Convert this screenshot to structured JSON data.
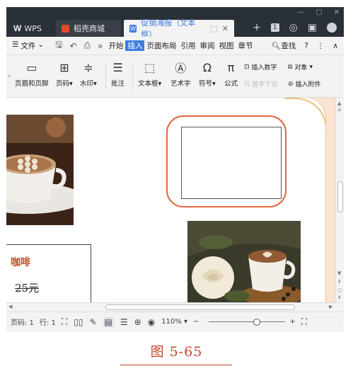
{
  "titlebar": {
    "app_name": "WPS",
    "tabs": [
      {
        "label": "稻壳商城",
        "icon": "fire-icon"
      },
      {
        "label": "促销海报（文本框）",
        "icon": "writer-doc-icon",
        "active": true
      }
    ],
    "new_tab": "+",
    "badge": "1"
  },
  "menubar": {
    "file": "文件",
    "overflow": "»",
    "items": [
      "开始",
      "插入",
      "页面布局",
      "引用",
      "审阅",
      "视图",
      "章节"
    ],
    "active_item": "插入",
    "search": "查找",
    "help": "?",
    "more": "⋮",
    "collapse": "∧"
  },
  "ribbon": {
    "header_footer": "页眉和页脚",
    "page_number": "页码",
    "watermark": "水印",
    "comment": "批注",
    "textbox": "文本框",
    "wordart": "艺术字",
    "symbol": "符号",
    "formula": "公式",
    "insert_number": "插入数字",
    "object": "对象",
    "drop_cap": "首字下沉",
    "attachment": "插入附件",
    "dropdown": "▾"
  },
  "document": {
    "price_item_name": "咖啡",
    "price_item_price": "25元"
  },
  "statusbar": {
    "page": "页码: 1",
    "line": "行: 1",
    "zoom": "110%",
    "zoom_out": "−",
    "zoom_in": "+",
    "zoom_percent": 0.64
  },
  "caption": "图 5-65",
  "colors": {
    "accent": "#3e7de0",
    "highlight": "#e3663f",
    "titlebar": "#2a3037",
    "caption": "#c8462a"
  }
}
